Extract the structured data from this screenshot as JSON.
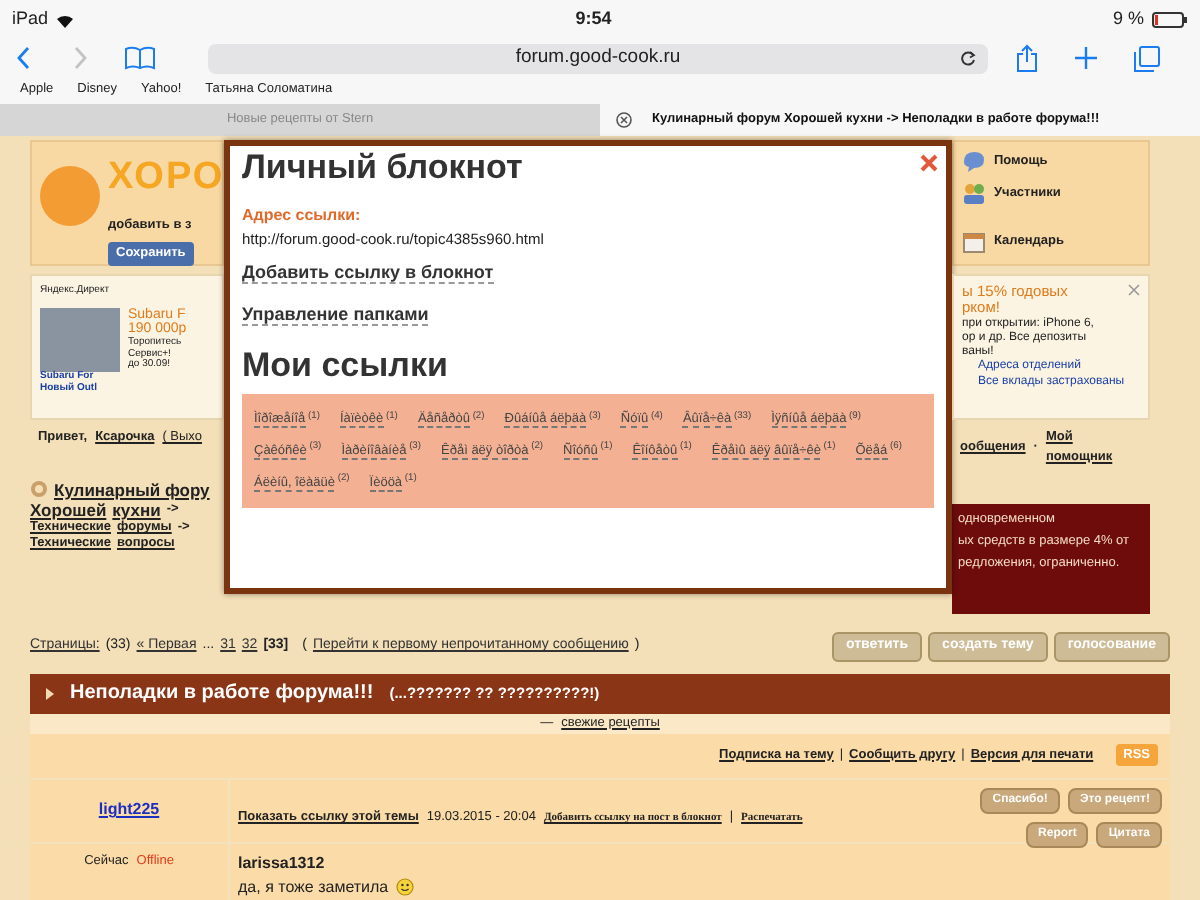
{
  "status_bar": {
    "carrier": "iPad",
    "time": "9:54",
    "battery": "9 %"
  },
  "browser": {
    "url": "forum.good-cook.ru",
    "bookmarks": [
      "Apple",
      "Disney",
      "Yahoo!",
      "Татьяна Соломатина"
    ],
    "tabs": [
      {
        "title": "Новые рецепты от Stern",
        "selected": false
      },
      {
        "title": "Кулинарный форум Хорошей кухни -> Неполадки в работе форума!!!",
        "selected": true
      }
    ]
  },
  "left": {
    "logo_text": "ХОРО",
    "add_text": "добавить в з",
    "save_button": "Сохранить",
    "ad_label": "Яндекс.Директ",
    "ad_titles": [
      "Subaru F",
      "190 000р"
    ],
    "ad_body": [
      "Торопитесь",
      "Сервис+!",
      "до 30.09!"
    ],
    "ad_links": [
      "Subaru For",
      "Новый Outl"
    ],
    "greeting": "Привет,",
    "user": "Ксарочка",
    "logout": "( Выхо",
    "breadcrumb": [
      {
        "kind": "title",
        "text": "Кулинарный фору"
      },
      {
        "kind": "title",
        "text": "Хорошей"
      },
      {
        "kind": "title",
        "text": "кухни"
      },
      {
        "kind": "sep",
        "text": "->"
      },
      {
        "kind": "link",
        "text": "Технические"
      },
      {
        "kind": "link",
        "text": "форумы"
      },
      {
        "kind": "sep",
        "text": "->"
      },
      {
        "kind": "link",
        "text": "Технические"
      },
      {
        "kind": "link",
        "text": "вопросы"
      }
    ]
  },
  "modal": {
    "title": "Личный блокнот",
    "address_label": "Адрес ссылки:",
    "address": "http://forum.good-cook.ru/topic4385s960.html",
    "actions": [
      "Добавить ссылку в блокнот",
      "Управление папками"
    ],
    "links_title": "Мои ссылки",
    "folders": [
      {
        "name": "Ìîðîæåíîå",
        "count": "(1)"
      },
      {
        "name": "Íàïèòêè",
        "count": "(1)"
      },
      {
        "name": "Äåñåðòû",
        "count": "(2)"
      },
      {
        "name": "Ðûáíûå áëþäà",
        "count": "(3)"
      },
      {
        "name": "Ñóïû",
        "count": "(4)"
      },
      {
        "name": "Âûïå÷êà",
        "count": "(33)"
      },
      {
        "name": "Ìÿñíûå áëþäà",
        "count": "(9)"
      },
      {
        "name": "Çàêóñêè",
        "count": "(3)"
      },
      {
        "name": "Ìàðèíîâàíèå",
        "count": "(3)"
      },
      {
        "name": "Êðåì äëÿ òîðòà",
        "count": "(2)"
      },
      {
        "name": "Ñîóñû",
        "count": "(1)"
      },
      {
        "name": "Êîíôåòû",
        "count": "(1)"
      },
      {
        "name": "Êðåìû äëÿ âûïå÷êè",
        "count": "(1)"
      },
      {
        "name": "Õëåá",
        "count": "(6)"
      },
      {
        "name": "Áëèíû, îëàäüè",
        "count": "(2)"
      },
      {
        "name": "Ïèööà",
        "count": "(1)"
      }
    ]
  },
  "right": {
    "menu": [
      {
        "label": "Помощь",
        "kind": "help"
      },
      {
        "label": "Участники",
        "kind": "users"
      },
      {
        "label": "Календарь",
        "kind": "calendar"
      }
    ],
    "ad_titles": [
      "ы 15% годовых",
      "рком!"
    ],
    "ad_body": [
      "при открытии: iPhone 6,",
      "ор и др. Все депозиты",
      "ваны!"
    ],
    "ad_links": [
      "Адреса отделений",
      "Все вклады застрахованы"
    ],
    "messages": "ообщения",
    "separator": "·",
    "assistant": "Мой помощник",
    "banner": [
      "одновременном",
      "ых средств в размере 4% от",
      "редложения, ограниченно."
    ]
  },
  "pagination": {
    "label": "Страницы:",
    "total": "(33)",
    "first": "« Первая",
    "ellipsis": "...",
    "pages": [
      {
        "label": "31",
        "selected": false
      },
      {
        "label": "32",
        "selected": false
      },
      {
        "label": "[33]",
        "selected": true
      }
    ],
    "open_paren": "(",
    "unread": "Перейти к первому непрочитанному сообщению",
    "close_paren": ")"
  },
  "topic_buttons": [
    "ответить",
    "создать тему",
    "голосование"
  ],
  "topic": {
    "title": "Неполадки в работе форума!!!",
    "subtitle": "(...??????? ?? ??????????!)",
    "dash": "—",
    "fresh": "свежие рецепты",
    "options": [
      "Подписка на тему",
      "Сообщить другу",
      "Версия для печати"
    ],
    "option_separator": "|",
    "rss": "RSS"
  },
  "post": {
    "author": "light225",
    "show_link": "Показать ссылку этой темы",
    "date": "19.03.2015 - 20:04",
    "actions": [
      "Добавить ссылку на пост в блокнот",
      "Распечатать"
    ],
    "action_separator": "|",
    "buttons": [
      "Спасибо!",
      "Это рецепт!",
      "Report",
      "Цитата"
    ],
    "status_label": "Сейчас",
    "status": "Offline",
    "quote_author": "larissa1312",
    "text": "да, я тоже заметила"
  }
}
